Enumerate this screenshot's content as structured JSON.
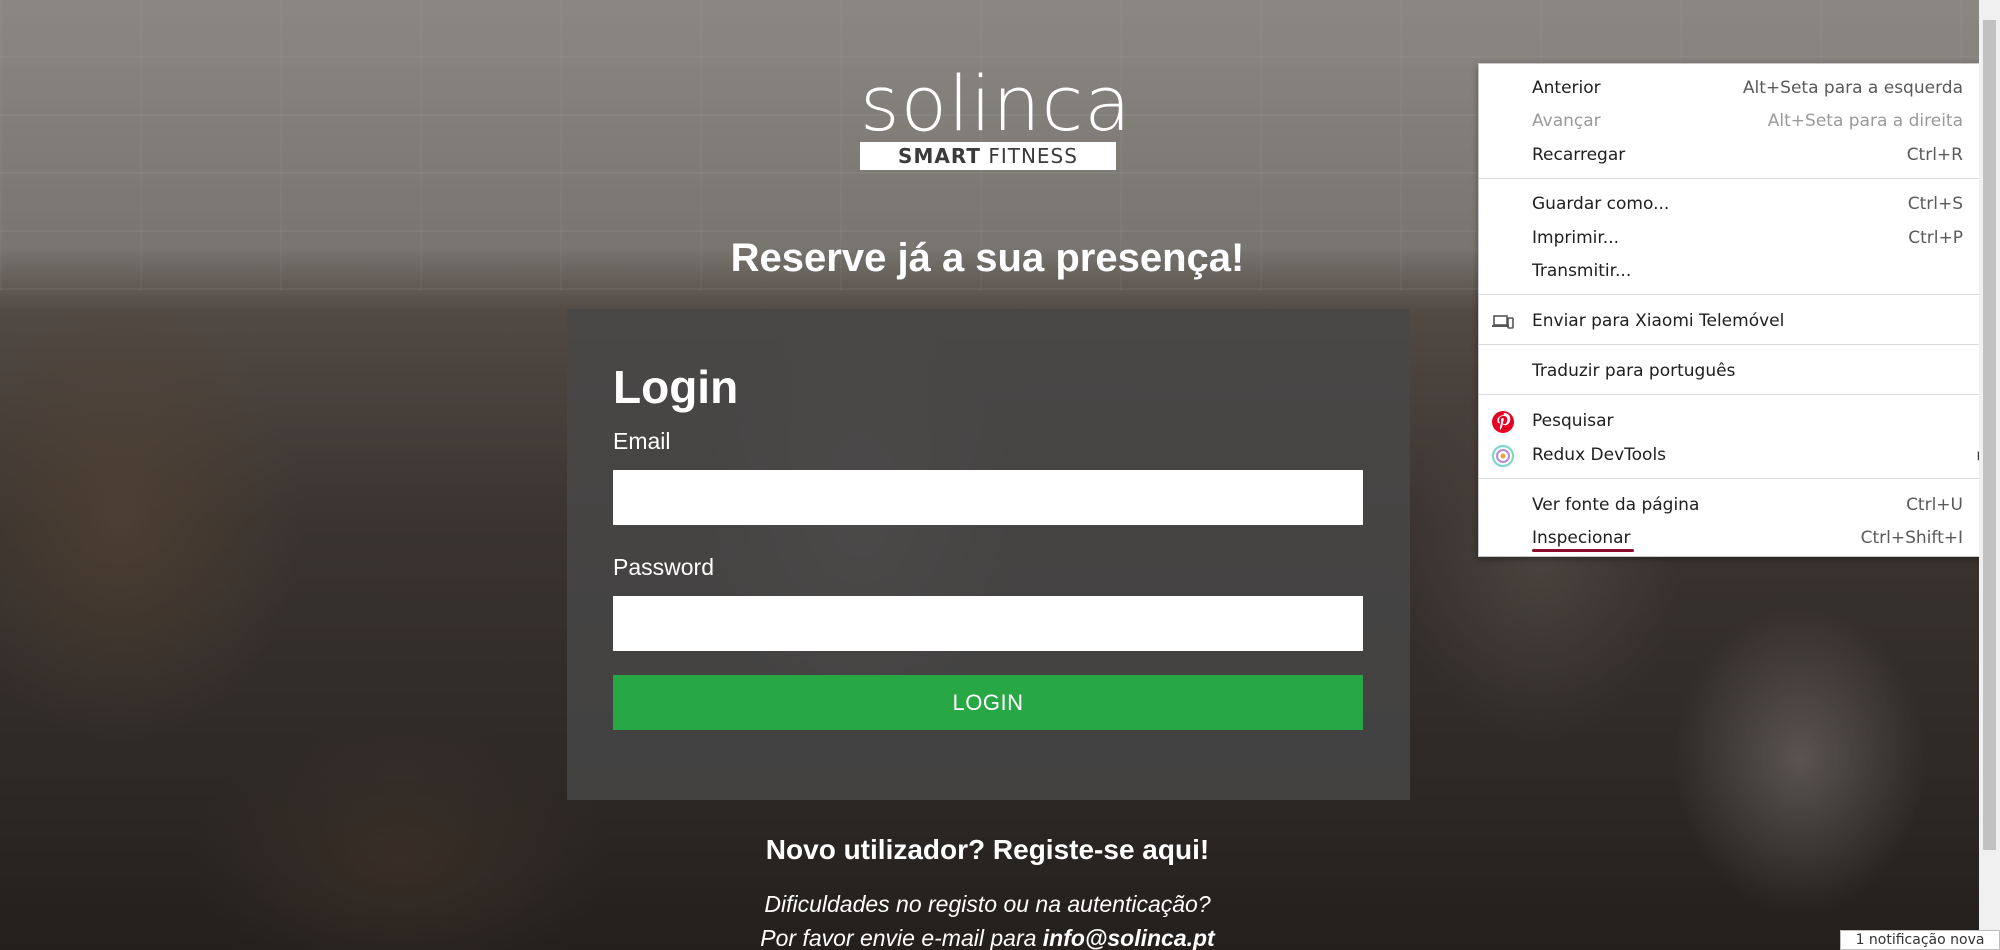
{
  "logo": {
    "wordmark": "solinca",
    "subtitle_bold": "SMART",
    "subtitle_rest": " FITNESS"
  },
  "tagline": "Reserve já a sua presença!",
  "login": {
    "title": "Login",
    "email_label": "Email",
    "email_value": "",
    "password_label": "Password",
    "password_value": "",
    "button_label": "LOGIN",
    "button_color": "#28a745"
  },
  "register_link": "Novo utilizador? Registe-se aqui!",
  "help": {
    "line1": "Dificuldades no registo ou na autenticação?",
    "line2_prefix": "Por favor envie e-mail para ",
    "email": "info@solinca.pt"
  },
  "context_menu": {
    "items": [
      {
        "label": "Anterior",
        "shortcut": "Alt+Seta para a esquerda",
        "enabled": true
      },
      {
        "label": "Avançar",
        "shortcut": "Alt+Seta para a direita",
        "enabled": false
      },
      {
        "label": "Recarregar",
        "shortcut": "Ctrl+R",
        "enabled": true
      },
      {
        "label": "Guardar como...",
        "shortcut": "Ctrl+S",
        "enabled": true
      },
      {
        "label": "Imprimir...",
        "shortcut": "Ctrl+P",
        "enabled": true
      },
      {
        "label": "Transmitir...",
        "shortcut": "",
        "enabled": true
      },
      {
        "label": "Enviar para Xiaomi Telemóvel",
        "shortcut": "",
        "icon": "device-icon",
        "enabled": true
      },
      {
        "label": "Traduzir para português",
        "shortcut": "",
        "enabled": true
      },
      {
        "label": "Pesquisar",
        "shortcut": "",
        "icon": "pinterest-icon",
        "enabled": true
      },
      {
        "label": "Redux DevTools",
        "shortcut": "",
        "icon": "redux-icon",
        "submenu": true,
        "enabled": true
      },
      {
        "label": "Ver fonte da página",
        "shortcut": "Ctrl+U",
        "enabled": true
      },
      {
        "label": "Inspecionar",
        "shortcut": "Ctrl+Shift+I",
        "enabled": true
      }
    ]
  },
  "notification": "1 notificação nova"
}
